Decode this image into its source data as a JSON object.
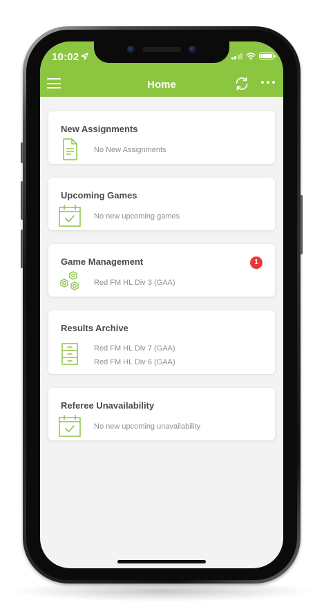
{
  "status_bar": {
    "time": "10:02"
  },
  "nav": {
    "title": "Home"
  },
  "cards": [
    {
      "title": "New Assignments",
      "icon": "document-icon",
      "lines": [
        "No New Assignments"
      ]
    },
    {
      "title": "Upcoming Games",
      "icon": "calendar-check-icon",
      "lines": [
        "No new upcoming games"
      ]
    },
    {
      "title": "Game Management",
      "icon": "gears-icon",
      "badge": "1",
      "lines": [
        "Red FM HL Div 3 (GAA)"
      ]
    },
    {
      "title": "Results Archive",
      "icon": "file-cabinet-icon",
      "lines": [
        "Red FM HL Div 7 (GAA)",
        "Red FM HL Div 6 (GAA)"
      ]
    },
    {
      "title": "Referee Unavailability",
      "icon": "calendar-check-icon",
      "lines": [
        "No new upcoming unavailability"
      ]
    }
  ],
  "colors": {
    "accent": "#8cc540",
    "badge": "#e8393c",
    "card_title": "#4a4a4a",
    "muted_text": "#8f8f8f",
    "background": "#f3f3f3"
  }
}
